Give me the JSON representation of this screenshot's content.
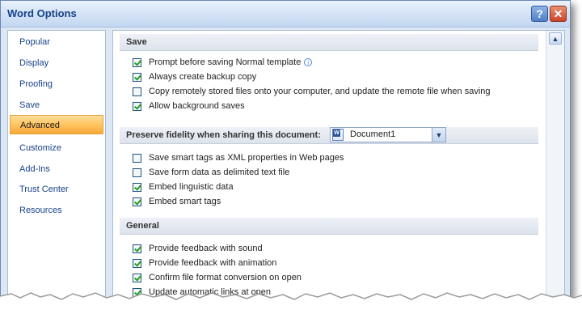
{
  "window": {
    "title": "Word Options"
  },
  "titlebar": {
    "help_glyph": "?",
    "close_glyph": "✕"
  },
  "sidebar": {
    "items": [
      {
        "label": "Popular"
      },
      {
        "label": "Display"
      },
      {
        "label": "Proofing"
      },
      {
        "label": "Save"
      },
      {
        "label": "Advanced",
        "selected": true
      },
      {
        "label": "Customize"
      },
      {
        "label": "Add-Ins"
      },
      {
        "label": "Trust Center"
      },
      {
        "label": "Resources"
      }
    ]
  },
  "sections": {
    "save": {
      "header": "Save",
      "options": [
        {
          "label": "Prompt before saving Normal template",
          "checked": true,
          "info": true
        },
        {
          "label": "Always create backup copy",
          "checked": true
        },
        {
          "label": "Copy remotely stored files onto your computer, and update the remote file when saving",
          "checked": false
        },
        {
          "label": "Allow background saves",
          "checked": true
        }
      ]
    },
    "fidelity": {
      "header": "Preserve fidelity when sharing this document:",
      "document_select": {
        "value": "Document1"
      },
      "options": [
        {
          "label": "Save smart tags as XML properties in Web pages",
          "checked": false
        },
        {
          "label": "Save form data as delimited text file",
          "checked": false
        },
        {
          "label": "Embed linguistic data",
          "checked": true
        },
        {
          "label": "Embed smart tags",
          "checked": true
        }
      ]
    },
    "general": {
      "header": "General",
      "options": [
        {
          "label": "Provide feedback with sound",
          "checked": true
        },
        {
          "label": "Provide feedback with animation",
          "checked": true
        },
        {
          "label": "Confirm file format conversion on open",
          "checked": true
        },
        {
          "label": "Update automatic links at open",
          "checked": true
        }
      ]
    }
  },
  "icons": {
    "info": "info-icon",
    "document": "word-document-icon",
    "dropdown": "chevron-down-icon",
    "scroll_up": "chevron-up-icon"
  },
  "colors": {
    "title_text": "#15428b",
    "selected_nav": "#f9a838",
    "check_mark": "#21a121"
  }
}
